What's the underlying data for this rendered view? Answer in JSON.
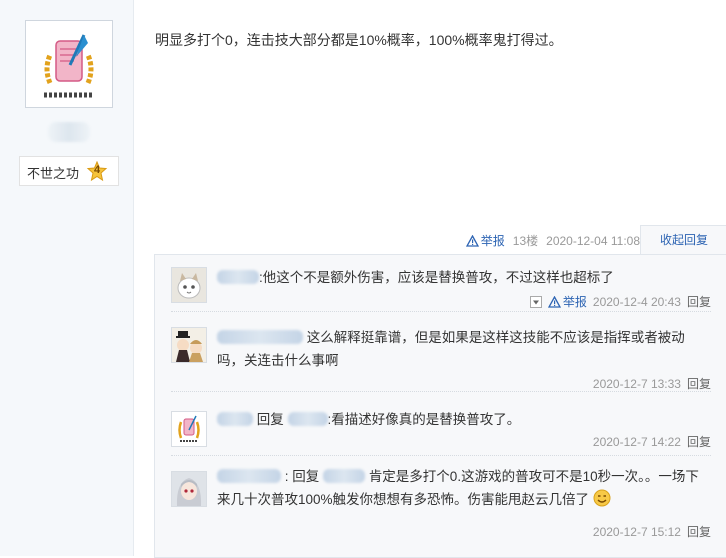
{
  "user": {
    "badge_title": "不世之功",
    "badge_level": "4"
  },
  "post": {
    "text": "明显多打个0，连击技大部分都是10%概率，100%概率鬼打得过。",
    "report_label": "举报",
    "floor": "13楼",
    "time": "2020-12-04 11:08",
    "collapse_label": "收起回复"
  },
  "replies": [
    {
      "content": ":他这个不是额外伤害，应该是替换普攻，不过这样也超标了",
      "report_label": "举报",
      "time": "2020-12-4 20:43",
      "reply_label": "回复"
    },
    {
      "content": "这么解释挺靠谱，但是如果是这样这技能不应该是指挥或者被动吗，关连击什么事啊",
      "time": "2020-12-7 13:33",
      "reply_label": "回复"
    },
    {
      "prefix": "回复",
      "content": ":看描述好像真的是替换普攻了。",
      "time": "2020-12-7 14:22",
      "reply_label": "回复"
    },
    {
      "prefix": ": 回复",
      "content": "肯定是多打个0.这游戏的普攻可不是10秒一次。。一场下来几十次普攻100%触发你想想有多恐怖。伤害能甩赵云几倍了",
      "time": "2020-12-7 15:12",
      "reply_label": "回复"
    }
  ],
  "colors": {
    "link": "#2d64b3",
    "meta": "#999999",
    "sidebar_bg": "#f5f8fb",
    "reply_bg": "#f7f8fa"
  },
  "icons": {
    "report": "warning-triangle-icon",
    "dropdown": "chevron-down-icon",
    "emoji": "smile-emoji-icon"
  }
}
